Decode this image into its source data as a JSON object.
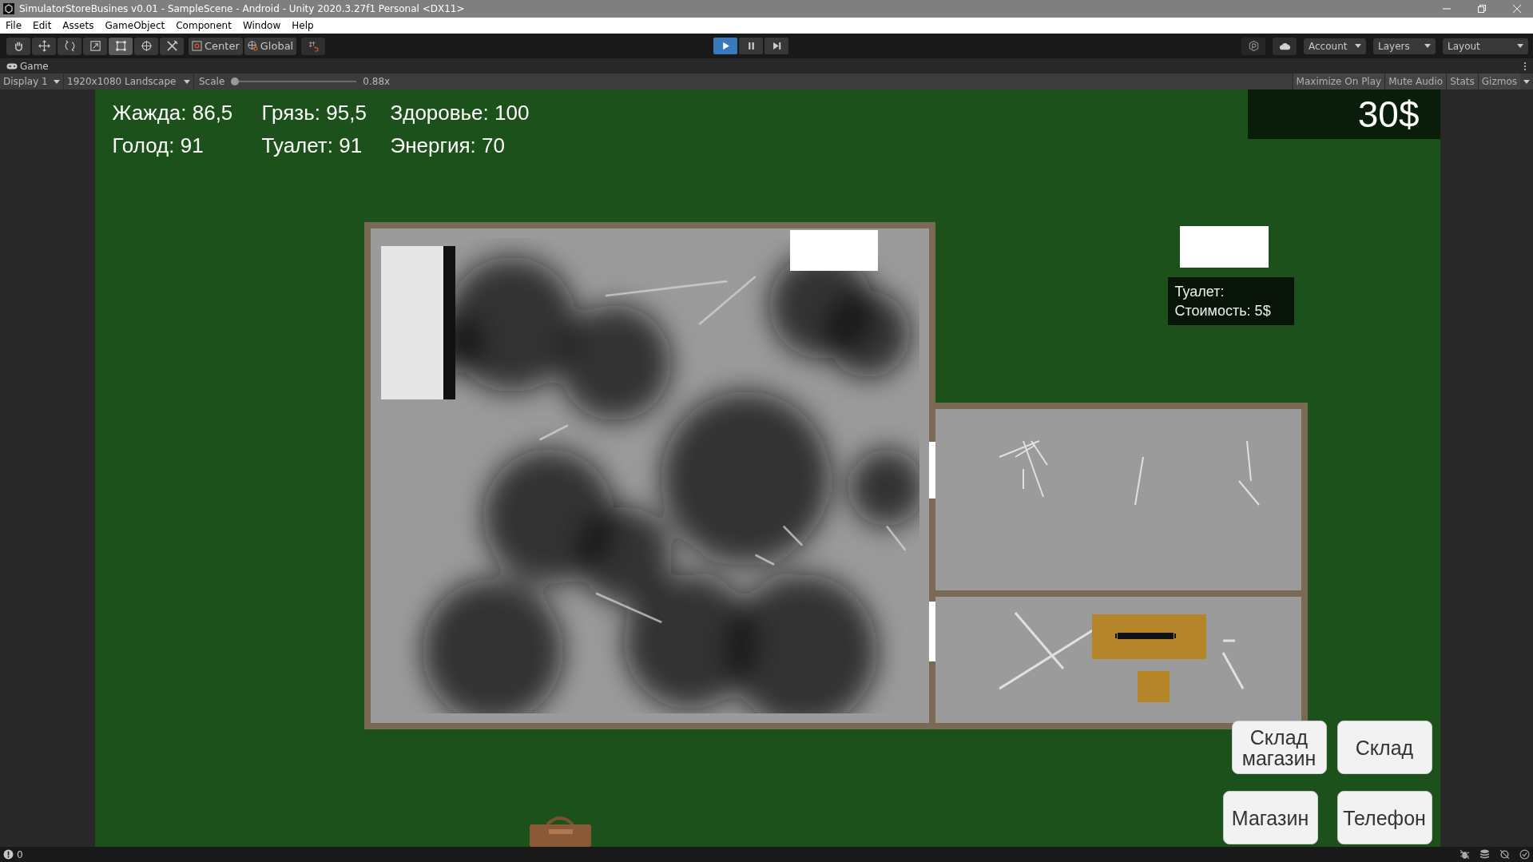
{
  "window": {
    "title": "SimulatorStoreBusines v0.01 - SampleScene - Android - Unity 2020.3.27f1 Personal <DX11>"
  },
  "menu": [
    "File",
    "Edit",
    "Assets",
    "GameObject",
    "Component",
    "Window",
    "Help"
  ],
  "tools": [
    {
      "kind": "hand",
      "selected": false
    },
    {
      "kind": "move",
      "selected": false
    },
    {
      "kind": "rotate",
      "selected": false
    },
    {
      "kind": "scale",
      "selected": false
    },
    {
      "kind": "rect",
      "selected": true
    },
    {
      "kind": "transform",
      "selected": false
    },
    {
      "kind": "custom",
      "selected": false
    }
  ],
  "pivot": [
    {
      "kind": "center",
      "label": "Center"
    },
    {
      "kind": "global",
      "label": "Global"
    }
  ],
  "playback": [
    {
      "kind": "play",
      "on": true
    },
    {
      "kind": "pause",
      "on": false
    },
    {
      "kind": "step",
      "on": false
    }
  ],
  "right_menus": [
    "Account",
    "Layers",
    "Layout"
  ],
  "game_tab": {
    "label": "Game"
  },
  "game_bar": {
    "display": "Display 1",
    "resolution": "1920x1080 Landscape",
    "scale_label": "Scale",
    "scale": {
      "level": 0.02
    },
    "scale_reading": "0.88x",
    "toggles": [
      {
        "label": "Maximize On Play",
        "on": false
      },
      {
        "label": "Mute Audio",
        "on": false
      },
      {
        "label": "Stats",
        "on": false
      },
      {
        "label": "Gizmos",
        "on": false
      }
    ]
  },
  "hud": {
    "stats": [
      "Жажда: 86,5",
      "Грязь: 95,5",
      "Здоровье: 100",
      "Голод: 91",
      "Туалет: 91",
      "Энергия: 70"
    ],
    "money": "30$"
  },
  "shop_tooltip": [
    "Туалет:",
    "Стоимость: 5$"
  ],
  "buttons": [
    "Склад магазин",
    "Склад",
    "Магазин",
    "Телефон"
  ],
  "status_bar": {
    "count": "0"
  }
}
